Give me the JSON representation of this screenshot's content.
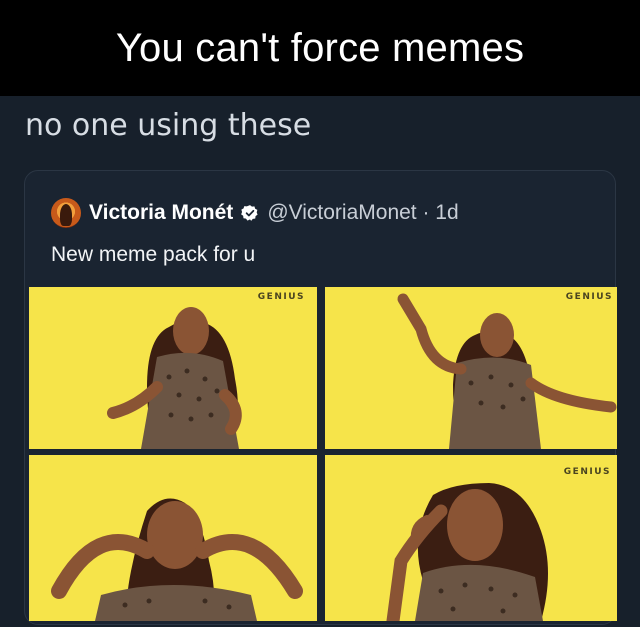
{
  "caption": "You can't force memes",
  "comment": "no one using these",
  "tweet": {
    "display_name": "Victoria Monét",
    "handle_time": "@VictoriaMonet · 1d",
    "text": "New meme pack for u",
    "verified_icon": "verified-badge-icon",
    "media": [
      {
        "watermark": "GENIUS"
      },
      {
        "watermark": "GENIUS"
      },
      {
        "watermark": ""
      },
      {
        "watermark": "GENIUS"
      }
    ]
  },
  "colors": {
    "caption_bg": "#000000",
    "page_bg": "#17202b",
    "tile_bg": "#f6e44a",
    "skin": "#8a5434",
    "hair": "#3b1e12",
    "top": "#6b5544"
  }
}
